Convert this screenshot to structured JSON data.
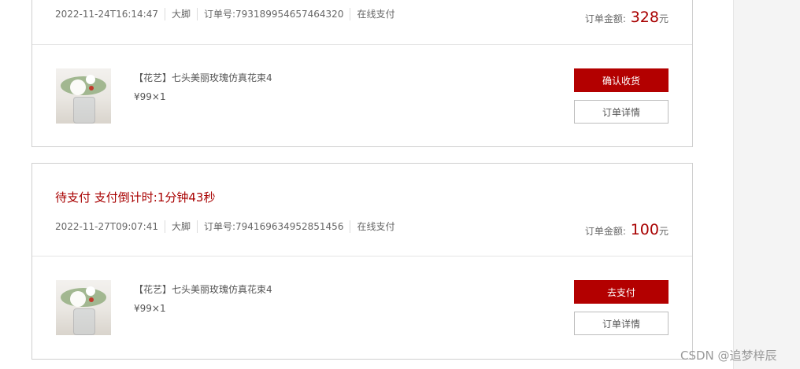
{
  "orders": [
    {
      "status": "",
      "date": "2022-11-24T16:14:47",
      "user": "大脚",
      "order_no": "订单号:793189954657464320",
      "payment": "在线支付",
      "total_label": "订单金额:",
      "total_amount": "328",
      "total_unit": "元",
      "product_name": "【花艺】七头美丽玫瑰仿真花束4",
      "product_price": "¥99×1",
      "primary_button": "确认收货",
      "secondary_button": "订单详情"
    },
    {
      "status": "待支付 支付倒计时:1分钟43秒",
      "date": "2022-11-27T09:07:41",
      "user": "大脚",
      "order_no": "订单号:794169634952851456",
      "payment": "在线支付",
      "total_label": "订单金额:",
      "total_amount": "100",
      "total_unit": "元",
      "product_name": "【花艺】七头美丽玫瑰仿真花束4",
      "product_price": "¥99×1",
      "primary_button": "去支付",
      "secondary_button": "订单详情"
    }
  ],
  "watermark": "CSDN @追梦梓辰",
  "colors": {
    "accent": "#b30000",
    "status_text": "#a80000"
  }
}
